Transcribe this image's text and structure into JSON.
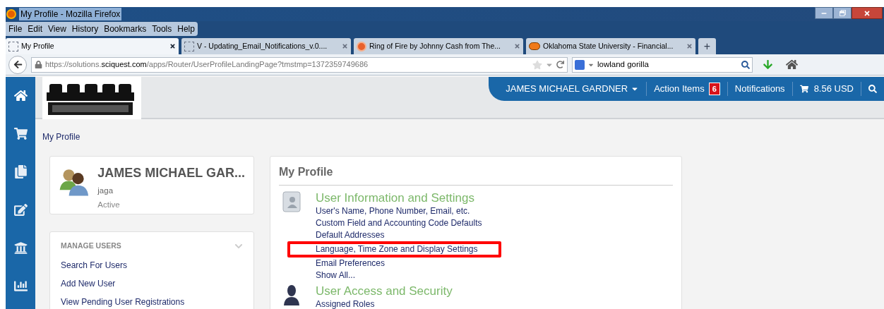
{
  "window": {
    "title": "My Profile - Mozilla Firefox"
  },
  "menu": [
    "File",
    "Edit",
    "View",
    "History",
    "Bookmarks",
    "Tools",
    "Help"
  ],
  "tabs": [
    {
      "label": "My Profile",
      "selected": true,
      "kind": "page"
    },
    {
      "label": "V - Updating_Email_Notifications_v.0....",
      "selected": false,
      "kind": "page"
    },
    {
      "label": "Ring of Fire by Johnny Cash from The...",
      "selected": false,
      "kind": "music"
    },
    {
      "label": "Oklahoma State University - Financial...",
      "selected": false,
      "kind": "osu"
    }
  ],
  "new_tab": "+",
  "address": {
    "pre": "https://solutions.",
    "domain": "sciquest.com",
    "post": "/apps/Router/UserProfileLandingPage?tmstmp=1372359749686"
  },
  "search": {
    "value": "lowland gorilla"
  },
  "sidebar": {
    "items": [
      {
        "kind": "home",
        "selected": true
      },
      {
        "kind": "cart",
        "selected": false
      },
      {
        "kind": "docs",
        "selected": false
      },
      {
        "kind": "edit",
        "selected": false
      },
      {
        "kind": "bank",
        "selected": false
      },
      {
        "kind": "chart",
        "selected": false
      }
    ]
  },
  "header": {
    "user": "JAMES MICHAEL GARDNER",
    "action_items": "Action Items",
    "action_count": "6",
    "notifications": "Notifications",
    "cart_total": "8.56 USD"
  },
  "breadcrumb": "My Profile",
  "user_card": {
    "name": "JAMES MICHAEL GAR...",
    "username": "jaga",
    "status": "Active"
  },
  "manage_users": {
    "title": "MANAGE USERS",
    "expanded": true,
    "links": [
      "Search For Users",
      "Add New User",
      "View Pending User Registrations"
    ]
  },
  "profile": {
    "title": "My Profile",
    "sections": [
      {
        "kind": "info",
        "title": "User Information and Settings",
        "links": [
          {
            "label": "User's Name, Phone Number, Email, etc.",
            "highlighted": false
          },
          {
            "label": "Custom Field and Accounting Code Defaults",
            "highlighted": false
          },
          {
            "label": "Default Addresses",
            "highlighted": false
          },
          {
            "label": "Language, Time Zone and Display Settings",
            "highlighted": true
          },
          {
            "label": "Email Preferences",
            "highlighted": false
          },
          {
            "label": "Show All...",
            "highlighted": false
          }
        ]
      },
      {
        "kind": "security",
        "title": "User Access and Security",
        "links": [
          {
            "label": "Assigned Roles",
            "highlighted": false
          }
        ]
      }
    ]
  }
}
